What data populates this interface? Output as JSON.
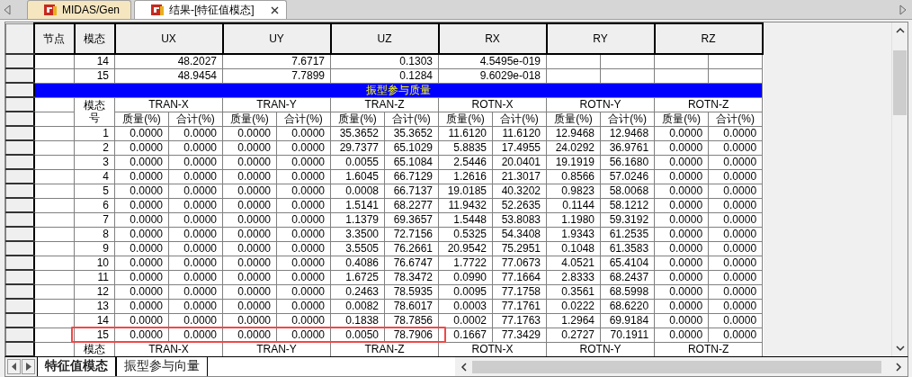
{
  "document_tabs": [
    {
      "label": "MIDAS/Gen",
      "selected": false
    },
    {
      "label": "结果-[特征值模态]",
      "selected": true
    }
  ],
  "eigen_table": {
    "columns": [
      "节点",
      "模态",
      "UX",
      "UY",
      "UZ",
      "RX",
      "RY",
      "RZ"
    ],
    "rows": [
      {
        "mode": "14",
        "values": [
          "48.2027",
          "7.6717",
          "0.1303",
          "4.5495e-019"
        ]
      },
      {
        "mode": "15",
        "values": [
          "48.9454",
          "7.7899",
          "0.1284",
          "9.6029e-018"
        ]
      }
    ]
  },
  "section_title": "振型参与质量",
  "mass_table": {
    "mode_header": "模态号",
    "groups": [
      "TRAN-X",
      "TRAN-Y",
      "TRAN-Z",
      "ROTN-X",
      "ROTN-Y",
      "ROTN-Z"
    ],
    "subcolumns": [
      "质量(%)",
      "合计(%)",
      "质量(%)",
      "合计(%)",
      "质量(%)",
      "合计(%)",
      "质量(%)",
      "合计(%)",
      "质量(%)",
      "合计(%)",
      "质量(%)",
      "合计(%)"
    ],
    "rows": [
      {
        "mode": "1",
        "highlighted": false,
        "values": [
          "0.0000",
          "0.0000",
          "0.0000",
          "0.0000",
          "35.3652",
          "35.3652",
          "11.6120",
          "11.6120",
          "12.9468",
          "12.9468",
          "0.0000",
          "0.0000"
        ]
      },
      {
        "mode": "2",
        "highlighted": false,
        "values": [
          "0.0000",
          "0.0000",
          "0.0000",
          "0.0000",
          "29.7377",
          "65.1029",
          "5.8835",
          "17.4955",
          "24.0292",
          "36.9761",
          "0.0000",
          "0.0000"
        ]
      },
      {
        "mode": "3",
        "highlighted": false,
        "values": [
          "0.0000",
          "0.0000",
          "0.0000",
          "0.0000",
          "0.0055",
          "65.1084",
          "2.5446",
          "20.0401",
          "19.1919",
          "56.1680",
          "0.0000",
          "0.0000"
        ]
      },
      {
        "mode": "4",
        "highlighted": false,
        "values": [
          "0.0000",
          "0.0000",
          "0.0000",
          "0.0000",
          "1.6045",
          "66.7129",
          "1.2616",
          "21.3017",
          "0.8566",
          "57.0246",
          "0.0000",
          "0.0000"
        ]
      },
      {
        "mode": "5",
        "highlighted": false,
        "values": [
          "0.0000",
          "0.0000",
          "0.0000",
          "0.0000",
          "0.0008",
          "66.7137",
          "19.0185",
          "40.3202",
          "0.9823",
          "58.0068",
          "0.0000",
          "0.0000"
        ]
      },
      {
        "mode": "6",
        "highlighted": false,
        "values": [
          "0.0000",
          "0.0000",
          "0.0000",
          "0.0000",
          "1.5141",
          "68.2277",
          "11.9432",
          "52.2635",
          "0.1144",
          "58.1212",
          "0.0000",
          "0.0000"
        ]
      },
      {
        "mode": "7",
        "highlighted": false,
        "values": [
          "0.0000",
          "0.0000",
          "0.0000",
          "0.0000",
          "1.1379",
          "69.3657",
          "1.5448",
          "53.8083",
          "1.1980",
          "59.3192",
          "0.0000",
          "0.0000"
        ]
      },
      {
        "mode": "8",
        "highlighted": false,
        "values": [
          "0.0000",
          "0.0000",
          "0.0000",
          "0.0000",
          "3.3500",
          "72.7156",
          "0.5325",
          "54.3408",
          "1.9343",
          "61.2535",
          "0.0000",
          "0.0000"
        ]
      },
      {
        "mode": "9",
        "highlighted": false,
        "values": [
          "0.0000",
          "0.0000",
          "0.0000",
          "0.0000",
          "3.5505",
          "76.2661",
          "20.9542",
          "75.2951",
          "0.1048",
          "61.3583",
          "0.0000",
          "0.0000"
        ]
      },
      {
        "mode": "10",
        "highlighted": false,
        "values": [
          "0.0000",
          "0.0000",
          "0.0000",
          "0.0000",
          "0.4086",
          "76.6747",
          "1.7722",
          "77.0673",
          "4.0521",
          "65.4104",
          "0.0000",
          "0.0000"
        ]
      },
      {
        "mode": "11",
        "highlighted": false,
        "values": [
          "0.0000",
          "0.0000",
          "0.0000",
          "0.0000",
          "1.6725",
          "78.3472",
          "0.0990",
          "77.1664",
          "2.8333",
          "68.2437",
          "0.0000",
          "0.0000"
        ]
      },
      {
        "mode": "12",
        "highlighted": false,
        "values": [
          "0.0000",
          "0.0000",
          "0.0000",
          "0.0000",
          "0.2463",
          "78.5935",
          "0.0095",
          "77.1758",
          "0.3561",
          "68.5998",
          "0.0000",
          "0.0000"
        ]
      },
      {
        "mode": "13",
        "highlighted": false,
        "values": [
          "0.0000",
          "0.0000",
          "0.0000",
          "0.0000",
          "0.0082",
          "78.6017",
          "0.0003",
          "77.1761",
          "0.0222",
          "68.6220",
          "0.0000",
          "0.0000"
        ]
      },
      {
        "mode": "14",
        "highlighted": false,
        "values": [
          "0.0000",
          "0.0000",
          "0.0000",
          "0.0000",
          "0.1838",
          "78.7856",
          "0.0002",
          "77.1763",
          "1.2964",
          "69.9184",
          "0.0000",
          "0.0000"
        ]
      },
      {
        "mode": "15",
        "highlighted": true,
        "values": [
          "0.0000",
          "0.0000",
          "0.0000",
          "0.0000",
          "0.0050",
          "78.7906",
          "0.1667",
          "77.3429",
          "0.2727",
          "70.1911",
          "0.0000",
          "0.0000"
        ]
      }
    ],
    "repeat_header": {
      "mode_header": "模态",
      "groups": [
        "TRAN-X",
        "TRAN-Y",
        "TRAN-Z",
        "ROTN-X",
        "ROTN-Y",
        "ROTN-Z"
      ]
    }
  },
  "sheet_tabs": [
    {
      "label": "特征值模态",
      "selected": true
    },
    {
      "label": "振型参与向量",
      "selected": false
    }
  ]
}
